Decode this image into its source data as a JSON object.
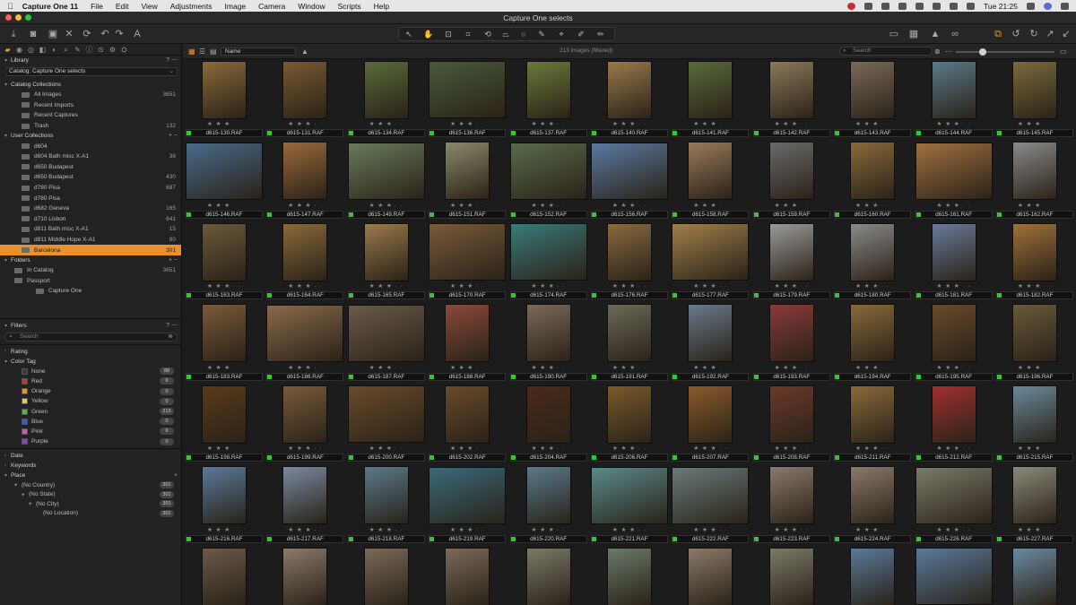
{
  "menubar": {
    "apple": "",
    "app_name": "Capture One 11",
    "items": [
      "File",
      "Edit",
      "View",
      "Adjustments",
      "Image",
      "Camera",
      "Window",
      "Scripts",
      "Help"
    ],
    "clock": "Tue 21:25"
  },
  "window": {
    "title": "Capture One selects"
  },
  "library": {
    "header": "Library",
    "catalog": "Catalog: Capture One selects",
    "catalog_collections_label": "Catalog Collections",
    "catalog_collections": [
      {
        "label": "All Images",
        "count": "3651"
      },
      {
        "label": "Recent Imports",
        "count": ""
      },
      {
        "label": "Recent Captures",
        "count": ""
      },
      {
        "label": "Trash",
        "count": "132"
      }
    ],
    "user_collections_label": "User Collections",
    "user_collections": [
      {
        "label": "d604",
        "count": ""
      },
      {
        "label": "d604 Bath misc X-A1",
        "count": "38"
      },
      {
        "label": "d650 Budapest",
        "count": ""
      },
      {
        "label": "d650 Budapest",
        "count": "430"
      },
      {
        "label": "d780 Pisa",
        "count": "687"
      },
      {
        "label": "d780 Pisa",
        "count": ""
      },
      {
        "label": "d682 Geneva",
        "count": "165"
      },
      {
        "label": "d710 Lisbon",
        "count": "641"
      },
      {
        "label": "d811 Bath misc X-A1",
        "count": "15"
      },
      {
        "label": "d811 Middle Hope X-A1",
        "count": "80"
      },
      {
        "label": "Barcelona",
        "count": "301",
        "selected": true
      }
    ],
    "folders_label": "Folders",
    "folders": [
      {
        "label": "In Catalog",
        "count": "3651"
      },
      {
        "label": "Passport",
        "count": ""
      },
      {
        "label": "Capture One",
        "count": ""
      }
    ]
  },
  "filters": {
    "header": "Filters",
    "search_placeholder": "Search",
    "rating_label": "Rating",
    "color_tag_label": "Color Tag",
    "color_tags": [
      {
        "label": "None",
        "count": "88",
        "color": "#3a3a3a"
      },
      {
        "label": "Red",
        "count": "0",
        "color": "#d03030"
      },
      {
        "label": "Orange",
        "count": "0",
        "color": "#e8912c"
      },
      {
        "label": "Yellow",
        "count": "0",
        "color": "#e0d030"
      },
      {
        "label": "Green",
        "count": "213",
        "color": "#35c535"
      },
      {
        "label": "Blue",
        "count": "0",
        "color": "#3060d0"
      },
      {
        "label": "Pink",
        "count": "0",
        "color": "#e050b0"
      },
      {
        "label": "Purple",
        "count": "0",
        "color": "#9040c0"
      }
    ],
    "date_label": "Date",
    "keywords_label": "Keywords",
    "place_label": "Place",
    "places": [
      {
        "label": "(No Country)",
        "count": "301"
      },
      {
        "label": "(No State)",
        "count": "301"
      },
      {
        "label": "(No City)",
        "count": "301"
      },
      {
        "label": "(No Location)",
        "count": "301"
      }
    ]
  },
  "browser": {
    "sort_by": "Name",
    "count_label": "213 images (filtered)",
    "search_placeholder": "Search",
    "rating_glyph": "★ ★ ★ · ·",
    "tag_color": "#35c535",
    "rows": [
      [
        "d615-130.RAF",
        "d615-131.RAF",
        "d615-134.RAF",
        "d615-136.RAF",
        "d615-137.RAF",
        "d615-140.RAF",
        "d615-141.RAF",
        "d615-142.RAF",
        "d615-143.RAF",
        "d615-144.RAF",
        "d615-145.RAF"
      ],
      [
        "d615-146.RAF",
        "d615-147.RAF",
        "d615-149.RAF",
        "d615-151.RAF",
        "d615-152.RAF",
        "d615-156.RAF",
        "d615-158.RAF",
        "d615-159.RAF",
        "d615-160.RAF",
        "d615-161.RAF",
        "d615-162.RAF"
      ],
      [
        "d615-163.RAF",
        "d615-164.RAF",
        "d615-165.RAF",
        "d615-170.RAF",
        "d615-174.RAF",
        "d615-176.RAF",
        "d615-177.RAF",
        "d615-179.RAF",
        "d615-180.RAF",
        "d615-181.RAF",
        "d615-182.RAF"
      ],
      [
        "d615-183.RAF",
        "d615-186.RAF",
        "d615-187.RAF",
        "d615-188.RAF",
        "d615-190.RAF",
        "d615-191.RAF",
        "d615-192.RAF",
        "d615-193.RAF",
        "d615-194.RAF",
        "d615-195.RAF",
        "d615-196.RAF"
      ],
      [
        "d615-198.RAF",
        "d615-199.RAF",
        "d615-200.RAF",
        "d615-202.RAF",
        "d615-204.RAF",
        "d615-206.RAF",
        "d615-207.RAF",
        "d615-208.RAF",
        "d615-211.RAF",
        "d615-212.RAF",
        "d615-215.RAF"
      ],
      [
        "d615-216.RAF",
        "d615-217.RAF",
        "d615-218.RAF",
        "d615-219.RAF",
        "d615-220.RAF",
        "d615-221.RAF",
        "d615-222.RAF",
        "d615-223.RAF",
        "d615-224.RAF",
        "d615-226.RAF",
        "d615-227.RAF"
      ],
      [
        "",
        "",
        "",
        "",
        "",
        "",
        "",
        "",
        "",
        "",
        ""
      ]
    ],
    "orientations": [
      [
        "p",
        "p",
        "p",
        "l",
        "p",
        "p",
        "p",
        "p",
        "p",
        "p",
        "p"
      ],
      [
        "l",
        "p",
        "l",
        "p",
        "l",
        "l",
        "p",
        "p",
        "p",
        "l",
        "p"
      ],
      [
        "p",
        "p",
        "p",
        "l",
        "l",
        "p",
        "l",
        "p",
        "p",
        "p",
        "p"
      ],
      [
        "p",
        "l",
        "l",
        "p",
        "p",
        "p",
        "p",
        "p",
        "p",
        "p",
        "p"
      ],
      [
        "p",
        "p",
        "l",
        "p",
        "p",
        "p",
        "p",
        "p",
        "p",
        "p",
        "p"
      ],
      [
        "p",
        "p",
        "p",
        "l",
        "p",
        "l",
        "l",
        "p",
        "p",
        "l",
        "p"
      ],
      [
        "p",
        "p",
        "p",
        "p",
        "p",
        "p",
        "p",
        "p",
        "p",
        "l",
        "p"
      ]
    ],
    "thumb_colors": [
      [
        "#8a6a3a",
        "#7a5a30",
        "#5a6a3a",
        "#4a5a3a",
        "#6a7a3a",
        "#9a7a4a",
        "#5a6a3a",
        "#8a7a5a",
        "#7a6a5a",
        "#5a7a8a",
        "#7a6a3a"
      ],
      [
        "#4a6a8a",
        "#9a6a3a",
        "#6a7a5a",
        "#8a8a6a",
        "#5a6a4a",
        "#5a7aa0",
        "#9a7a5a",
        "#6a6a6a",
        "#8a6a3a",
        "#a07040",
        "#8a8a8a"
      ],
      [
        "#6a5a3a",
        "#8a6a3a",
        "#9a7a4a",
        "#7a5a3a",
        "#3a7a7a",
        "#8a6a40",
        "#a0804a",
        "#9a9a9a",
        "#8a8a8a",
        "#6a7a9a",
        "#a0703a"
      ],
      [
        "#7a5a3a",
        "#8a6a4a",
        "#6a5a4a",
        "#8a4a3a",
        "#7a6a5a",
        "#6a6a5a",
        "#6a7a8a",
        "#8a3a3a",
        "#8a6a3a",
        "#6a4a2a",
        "#6a5a3a"
      ],
      [
        "#5a3a1a",
        "#7a5a3a",
        "#6a4a2a",
        "#6a4a2a",
        "#4a2a1a",
        "#7a5a2a",
        "#8a5a2a",
        "#6a3a2a",
        "#8a6a3a",
        "#a03030",
        "#6a8a9a"
      ],
      [
        "#5a7a9a",
        "#7a8aa0",
        "#5a7a8a",
        "#3a6a7a",
        "#5a7a8a",
        "#5a8a8a",
        "#6a7a7a",
        "#8a7a6a",
        "#8a7a6a",
        "#7a7a6a",
        "#8a8a7a"
      ],
      [
        "#6a5a4a",
        "#8a7a6a",
        "#7a6a5a",
        "#7a6a5a",
        "#7a7a6a",
        "#6a7a6a",
        "#8a7a6a",
        "#7a7a6a",
        "#5a7a9a",
        "#5a7a9a",
        "#6a8aa0"
      ]
    ]
  }
}
